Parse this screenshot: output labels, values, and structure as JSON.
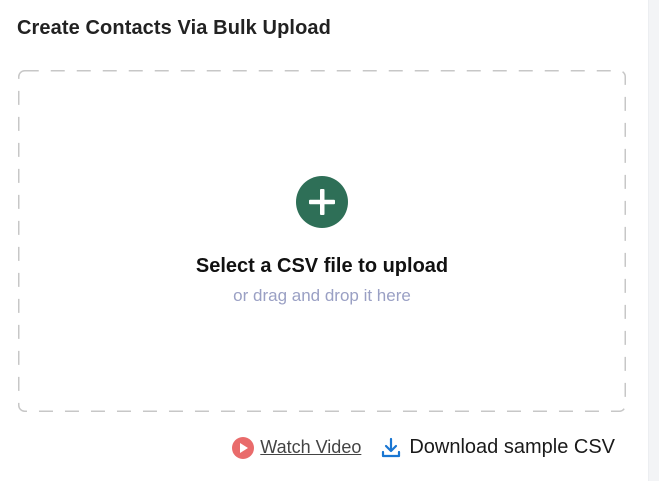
{
  "title": "Create Contacts Via Bulk Upload",
  "dropzone": {
    "primary": "Select a CSV file to upload",
    "secondary": "or drag and drop it here"
  },
  "actions": {
    "watch_video": "Watch Video",
    "download_sample": "Download sample CSV"
  },
  "icons": {
    "add": "plus-circle-icon",
    "play": "play-circle-icon",
    "download": "download-icon"
  },
  "colors": {
    "accent": "#2e6f57",
    "play": "#e96b6b",
    "download": "#1976d2",
    "subtle_text": "#9aa0c4"
  }
}
